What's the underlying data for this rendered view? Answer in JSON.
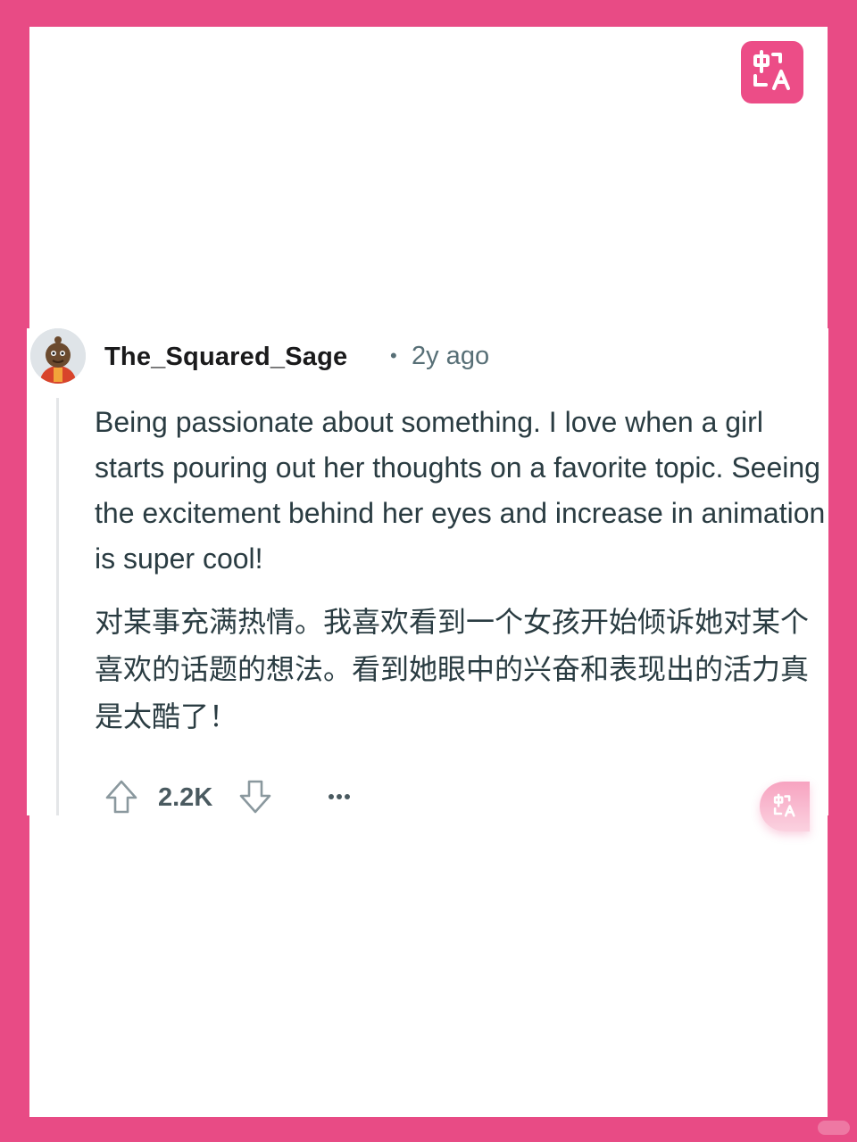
{
  "comment": {
    "username": "The_Squared_Sage",
    "separator": "•",
    "timestamp": "2y ago",
    "body_en": "Being passionate about something. I love when a girl starts pouring out her thoughts on a favorite topic. Seeing the excitement behind her eyes and increase in animation is super cool!",
    "body_zh": "对某事充满热情。我喜欢看到一个女孩开始倾诉她对某个喜欢的话题的想法。看到她眼中的兴奋和表现出的活力真是太酷了！",
    "score": "2.2K"
  },
  "icons": {
    "translate_badge": "translate-icon",
    "upvote": "arrow-up-icon",
    "downvote": "arrow-down-icon",
    "more": "more-horizontal-icon",
    "avatar": "avatar"
  },
  "colors": {
    "frame": "#e84b85",
    "badge": "#ec4d87",
    "text": "#2a3c42",
    "meta": "#576f76"
  }
}
